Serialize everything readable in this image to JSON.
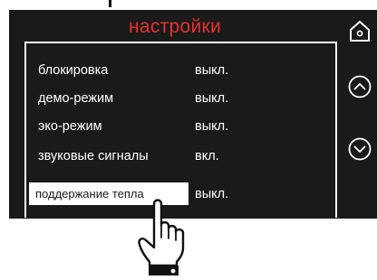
{
  "header": {
    "title": "настройки"
  },
  "settings": [
    {
      "label": "блокировка",
      "value": "выкл."
    },
    {
      "label": "демо-режим",
      "value": "выкл."
    },
    {
      "label": "эко-режим",
      "value": "выкл."
    },
    {
      "label": "звуковые сигналы",
      "value": "вкл."
    },
    {
      "label": "поддержание тепла",
      "value": "выкл.",
      "selected": true
    }
  ],
  "sidebar": {
    "home_icon": "home-icon",
    "scroll_up_icon": "chevron-up-circle-icon",
    "scroll_down_icon": "chevron-down-circle-icon"
  },
  "colors": {
    "title": "#e8312f",
    "screen": "#1a1a1a",
    "text": "#ffffff"
  }
}
